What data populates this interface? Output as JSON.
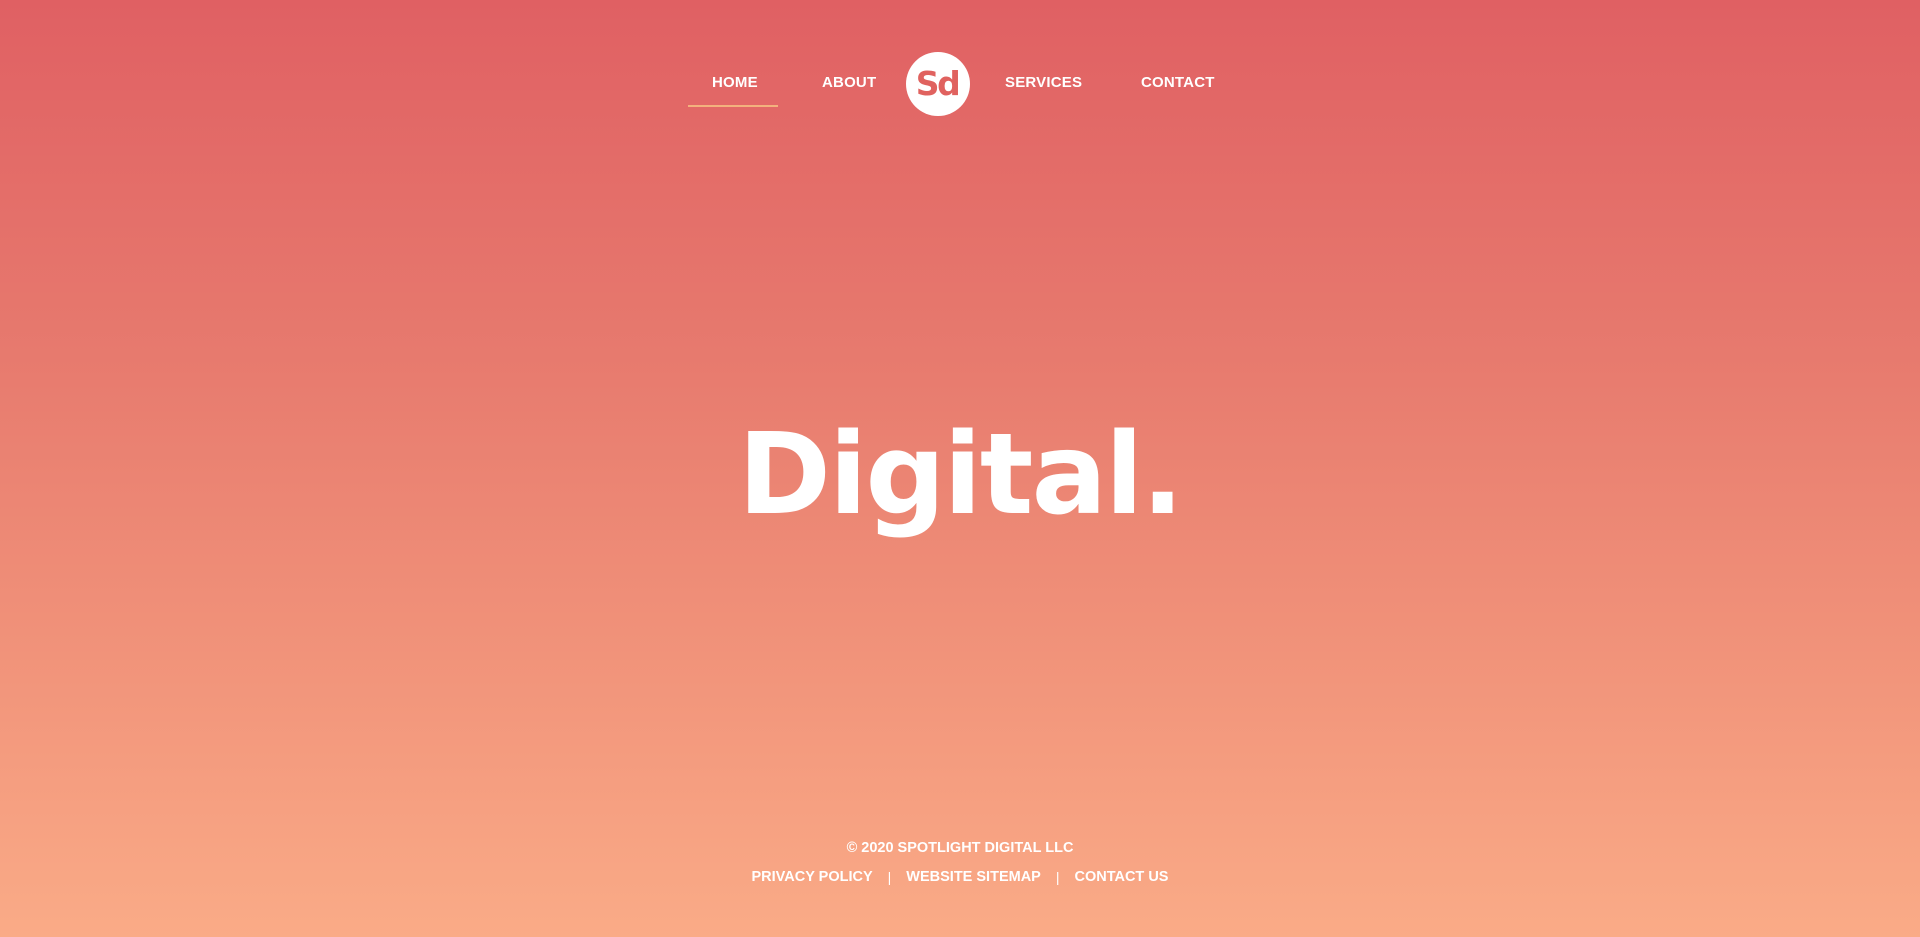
{
  "nav": {
    "items": [
      {
        "label": "HOME"
      },
      {
        "label": "ABOUT"
      },
      {
        "label": "SERVICES"
      },
      {
        "label": "CONTACT"
      }
    ],
    "active": "HOME",
    "logo_text": "Sd"
  },
  "hero": {
    "title": "Digital."
  },
  "footer": {
    "copyright": "© 2020 SPOTLIGHT DIGITAL LLC",
    "links": [
      {
        "label": "PRIVACY POLICY"
      },
      {
        "label": "WEBSITE SITEMAP"
      },
      {
        "label": "CONTACT US"
      }
    ],
    "separator": "|"
  },
  "colors": {
    "gradient_top": "#e06063",
    "gradient_bottom": "#faab87",
    "logo_text": "#e0625f",
    "active_underline": "#f3b27d",
    "text": "#ffffff"
  },
  "icons": {
    "logo": "sd-monogram-logo"
  }
}
